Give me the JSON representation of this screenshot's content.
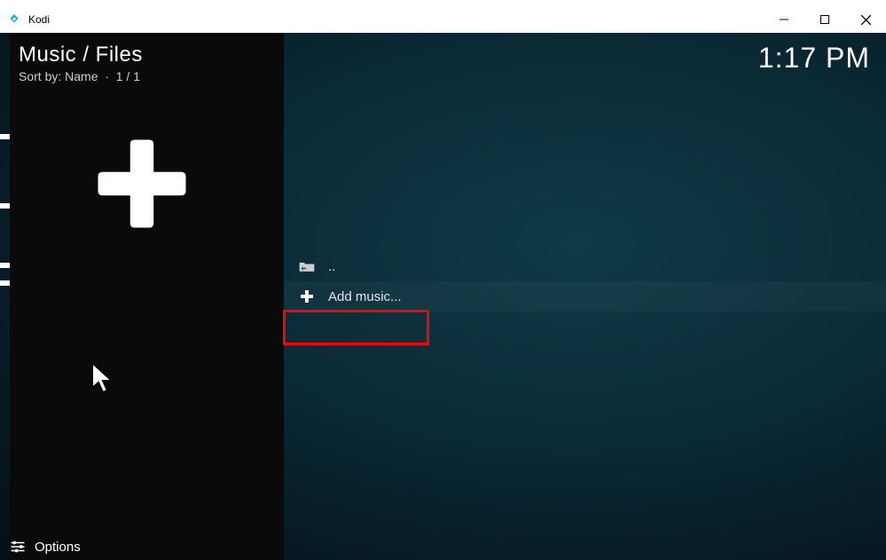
{
  "titlebar": {
    "app_name": "Kodi"
  },
  "header": {
    "breadcrumb": "Music / Files",
    "sort_label": "Sort by:",
    "sort_value": "Name",
    "count": "1 / 1"
  },
  "clock": "1:17 PM",
  "content": {
    "rows": [
      {
        "icon": "folder-back",
        "label": ".."
      },
      {
        "icon": "plus",
        "label": "Add music..."
      }
    ]
  },
  "footer": {
    "options_label": "Options"
  },
  "icons": {
    "logo": "kodi-logo",
    "minimize": "minimize-icon",
    "maximize": "maximize-icon",
    "close": "close-icon",
    "plus_large": "plus-icon",
    "folder_back": "folder-back-icon",
    "plus_small": "plus-icon",
    "slider": "slider-icon"
  },
  "highlight_box": {
    "target": "add-music-row",
    "color": "#ff0000"
  }
}
